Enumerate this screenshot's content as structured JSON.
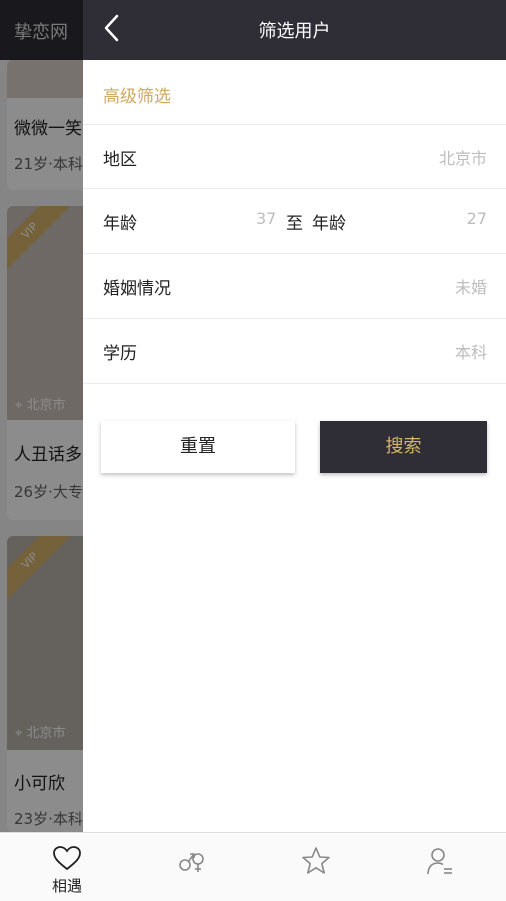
{
  "background_app": {
    "title": "挚恋网",
    "cards": [
      {
        "name": "微微一笑",
        "meta": "21岁·本科"
      },
      {
        "name": "人丑话多",
        "meta": "26岁·大专",
        "location": "北京市",
        "badge": "VIP"
      },
      {
        "name": "小可欣",
        "meta": "23岁·本科",
        "location": "北京市",
        "badge": "VIP"
      }
    ]
  },
  "drawer": {
    "title": "筛选用户",
    "section_title": "高级筛选",
    "rows": {
      "region": {
        "label": "地区",
        "value": "北京市"
      },
      "age": {
        "label": "年龄",
        "min": "37",
        "separator": "至",
        "label2": "年龄",
        "max": "27"
      },
      "marital": {
        "label": "婚姻情况",
        "value": "未婚"
      },
      "education": {
        "label": "学历",
        "value": "本科"
      }
    },
    "buttons": {
      "reset": "重置",
      "search": "搜索"
    }
  },
  "tabbar": {
    "tabs": [
      {
        "label": "相遇",
        "icon": "heart-icon",
        "active": true
      },
      {
        "label": "",
        "icon": "gender-match-icon"
      },
      {
        "label": "",
        "icon": "star-icon"
      },
      {
        "label": "",
        "icon": "user-icon"
      }
    ]
  },
  "colors": {
    "dark": "#2f2e36",
    "accent": "#cfa862",
    "muted": "#bdbdbd"
  }
}
